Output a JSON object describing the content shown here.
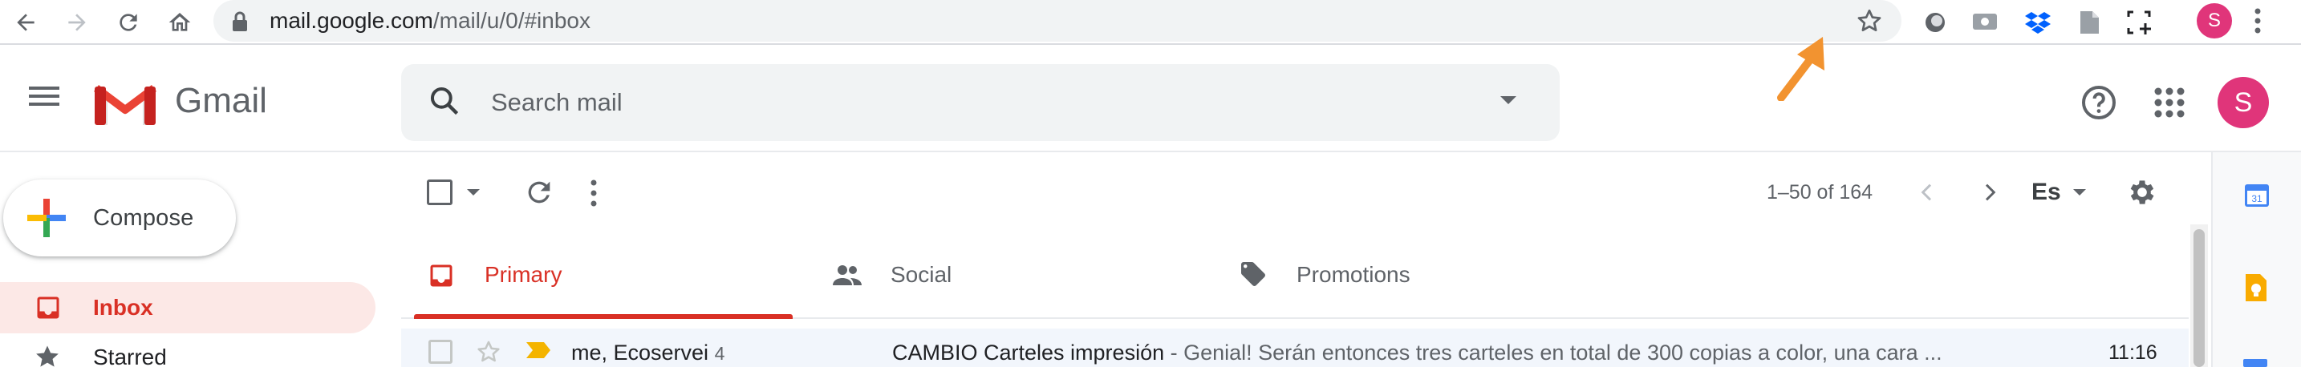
{
  "browser": {
    "url_host": "mail.google.com",
    "url_path": "/mail/u/0/#inbox",
    "profile_initial": "S"
  },
  "gmail": {
    "wordmark": "Gmail",
    "search_placeholder": "Search mail",
    "avatar_initial": "S"
  },
  "sidebar": {
    "compose_label": "Compose",
    "items": [
      {
        "label": "Inbox",
        "active": true
      },
      {
        "label": "Starred",
        "active": false
      }
    ]
  },
  "toolbar": {
    "pagination": "1–50 of 164",
    "input_language": "Es"
  },
  "tabs": [
    {
      "label": "Primary",
      "active": true
    },
    {
      "label": "Social",
      "active": false
    },
    {
      "label": "Promotions",
      "active": false
    }
  ],
  "emails": [
    {
      "sender": "me, Ecoservei",
      "count": "4",
      "subject": "CAMBIO Carteles impresión",
      "snippet": " - Genial! Serán entonces tres carteles en total de 300 copias a color, una cara ...",
      "time": "11:16",
      "important": true,
      "starred": false
    }
  ],
  "colors": {
    "accent_red": "#d93025",
    "avatar_pink": "#e0357a",
    "annotation_arrow": "#f29330"
  }
}
